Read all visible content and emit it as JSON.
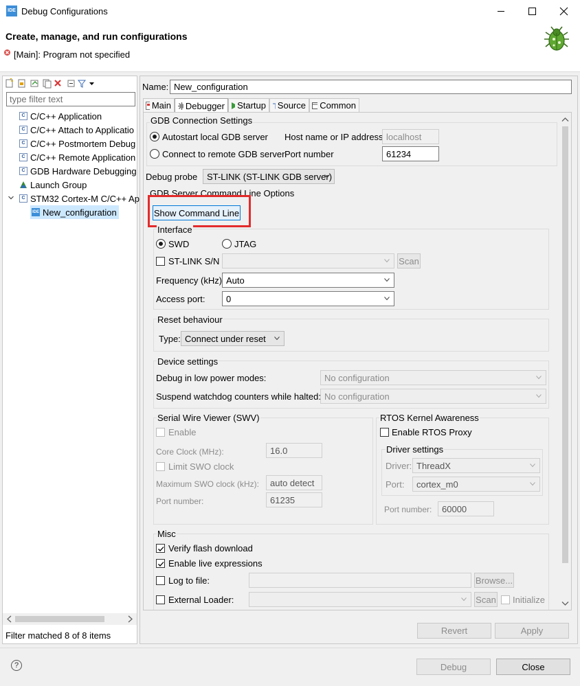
{
  "window": {
    "title": "Debug Configurations",
    "header_title": "Create, manage, and run configurations",
    "header_message": "[Main]: Program not specified",
    "app_icon_text": "IDE"
  },
  "sidebar": {
    "filter_placeholder": "type filter text",
    "items": [
      {
        "label": "C/C++ Application",
        "icon": "c-launch-icon"
      },
      {
        "label": "C/C++ Attach to Applicatio",
        "icon": "c-launch-icon"
      },
      {
        "label": "C/C++ Postmortem Debug",
        "icon": "c-launch-icon"
      },
      {
        "label": "C/C++ Remote Application",
        "icon": "c-launch-icon"
      },
      {
        "label": "GDB Hardware Debugging",
        "icon": "c-launch-icon"
      },
      {
        "label": "Launch Group",
        "icon": "launch-group-icon"
      },
      {
        "label": "STM32 Cortex-M C/C++ Ap",
        "icon": "c-launch-icon"
      },
      {
        "label": "New_configuration",
        "icon": "ide-icon"
      }
    ],
    "status": "Filter matched 8 of 8 items"
  },
  "config": {
    "name_label": "Name:",
    "name_value": "New_configuration",
    "tabs": [
      {
        "label": "Main"
      },
      {
        "label": "Debugger"
      },
      {
        "label": "Startup"
      },
      {
        "label": "Source"
      },
      {
        "label": "Common"
      }
    ]
  },
  "gdb": {
    "section_title": "GDB Connection Settings",
    "autostart_label": "Autostart local GDB server",
    "remote_label": "Connect to remote GDB server",
    "host_label": "Host name or IP address",
    "host_value": "localhost",
    "port_label": "Port number",
    "port_value": "61234",
    "probe_label": "Debug probe",
    "probe_value": "ST-LINK (ST-LINK GDB server)",
    "cmdline_title": "GDB Server Command Line Options",
    "show_cmdline_label": "Show Command Line"
  },
  "interface": {
    "title": "Interface",
    "swd_label": "SWD",
    "jtag_label": "JTAG",
    "stlink_sn_label": "ST-LINK S/N",
    "scan_label": "Scan",
    "frequency_label": "Frequency (kHz):",
    "frequency_value": "Auto",
    "access_port_label": "Access port:",
    "access_port_value": "0"
  },
  "reset": {
    "title": "Reset behaviour",
    "type_label": "Type:",
    "type_value": "Connect under reset"
  },
  "device": {
    "title": "Device settings",
    "low_power_label": "Debug in low power modes:",
    "low_power_value": "No configuration",
    "watchdog_label": "Suspend watchdog counters while halted:",
    "watchdog_value": "No configuration"
  },
  "swv": {
    "title": "Serial Wire Viewer (SWV)",
    "enable_label": "Enable",
    "core_clock_label": "Core Clock (MHz):",
    "core_clock_value": "16.0",
    "limit_swo_label": "Limit SWO clock",
    "max_swo_label": "Maximum SWO clock (kHz):",
    "max_swo_value": "auto detect",
    "port_label": "Port number:",
    "port_value": "61235"
  },
  "rtos": {
    "title": "RTOS Kernel Awareness",
    "enable_label": "Enable RTOS Proxy",
    "driver_settings_title": "Driver settings",
    "driver_label": "Driver:",
    "driver_value": "ThreadX",
    "port_label": "Port:",
    "port_value": "cortex_m0",
    "port_number_label": "Port number:",
    "port_number_value": "60000"
  },
  "misc": {
    "title": "Misc",
    "verify_flash_label": "Verify flash download",
    "live_expr_label": "Enable live expressions",
    "log_file_label": "Log to file:",
    "browse_label": "Browse...",
    "ext_loader_label": "External Loader:",
    "scan_label": "Scan",
    "initialize_label": "Initialize"
  },
  "buttons": {
    "revert": "Revert",
    "apply": "Apply",
    "debug": "Debug",
    "close": "Close"
  },
  "colors": {
    "highlight_box": "#e32b2b",
    "selection_bg": "#cce8ff",
    "error_icon": "#d9534f"
  }
}
